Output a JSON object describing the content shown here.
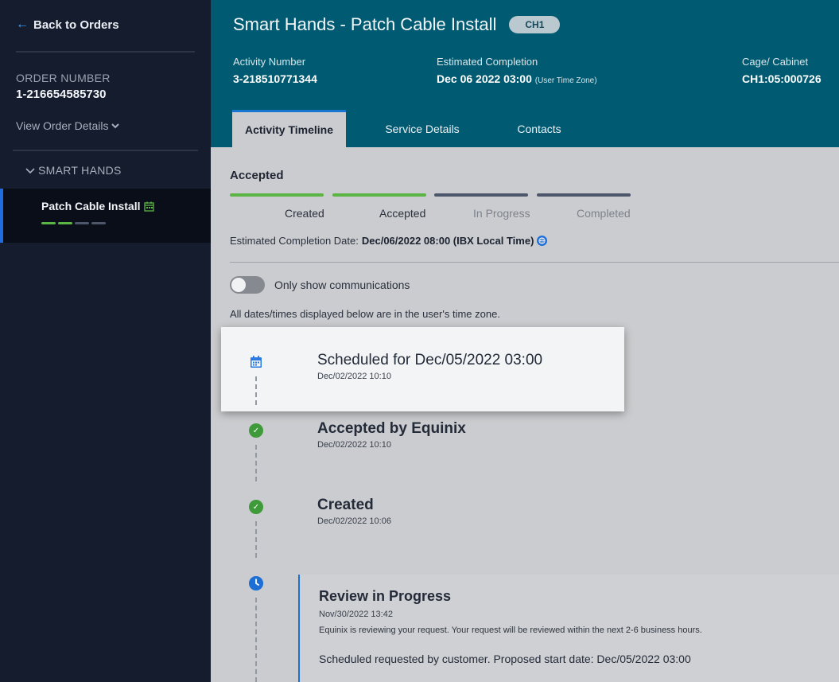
{
  "sidebar": {
    "back_label": "Back to Orders",
    "order_label": "ORDER NUMBER",
    "order_number": "1-216654585730",
    "view_details": "View Order Details",
    "section_label": "SMART HANDS",
    "item_label": "Patch Cable Install",
    "mini_progress": [
      1,
      1,
      0,
      0
    ]
  },
  "header": {
    "title": "Smart Hands - Patch Cable Install",
    "badge": "CH1",
    "activity_number_label": "Activity Number",
    "activity_number": "3-218510771344",
    "est_completion_label": "Estimated Completion",
    "est_completion": "Dec 06 2022 03:00",
    "est_completion_tz": "(User Time Zone)",
    "cage_label": "Cage/ Cabinet",
    "cage_value": "CH1:05:000726",
    "tabs": [
      "Activity Timeline",
      "Service Details",
      "Contacts"
    ]
  },
  "status": {
    "current": "Accepted",
    "stages": [
      {
        "label": "Created",
        "done": true
      },
      {
        "label": "Accepted",
        "done": true
      },
      {
        "label": "In Progress",
        "done": false
      },
      {
        "label": "Completed",
        "done": false
      }
    ],
    "est_date_label": "Estimated Completion Date:",
    "est_date_value": "Dec/06/2022 08:00 (IBX Local Time)",
    "toggle_label": "Only show communications",
    "tz_note": "All dates/times displayed below are in the user's time zone."
  },
  "timeline": [
    {
      "title": "Scheduled for Dec/05/2022 03:00",
      "date": "Dec/02/2022 10:10",
      "icon": "calendar-icon"
    },
    {
      "title": "Accepted by Equinix",
      "date": "Dec/02/2022 10:10",
      "icon": "check-icon"
    },
    {
      "title": "Created",
      "date": "Dec/02/2022 10:06",
      "icon": "check-icon"
    }
  ],
  "review": {
    "title": "Review in Progress",
    "date": "Nov/30/2022 13:42",
    "desc": "Equinix is reviewing your request. Your request will be reviewed within the next 2-6 business hours.",
    "scheduled": "Scheduled requested by customer. Proposed start date: Dec/05/2022 03:00",
    "icon": "clock-icon"
  },
  "colors": {
    "sidebar_bg": "#141c2e",
    "header_bg": "#005b72",
    "accent_blue": "#1d6fd6",
    "success_green": "#5bb544",
    "pending_gray": "#4d566a"
  }
}
